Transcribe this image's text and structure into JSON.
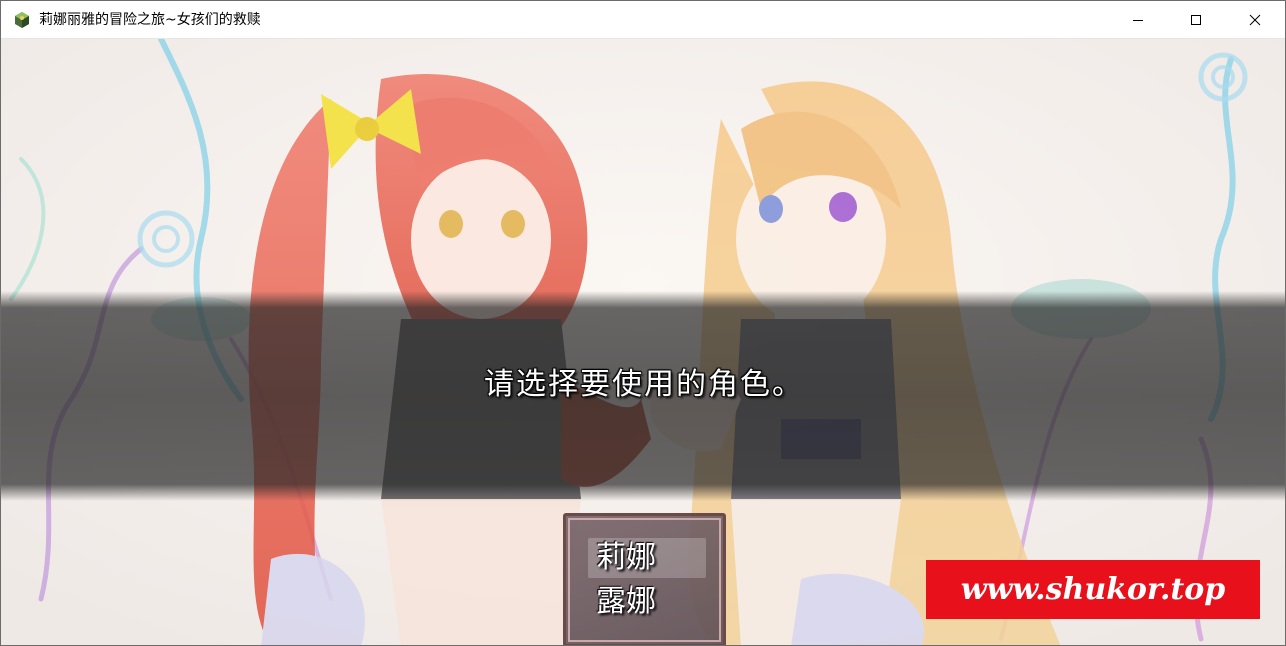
{
  "window": {
    "title": "莉娜丽雅的冒险之旅~女孩们的救赎",
    "controls": {
      "minimize_icon": "minimize-icon",
      "maximize_icon": "maximize-icon",
      "close_icon": "close-icon"
    }
  },
  "message": {
    "text": "请选择要使用的角色。"
  },
  "choices": {
    "selected_index": 0,
    "items": [
      {
        "label": "莉娜"
      },
      {
        "label": "露娜"
      }
    ]
  },
  "watermark": {
    "text": "www.shukor.top",
    "color": "#e8101a"
  },
  "colors": {
    "message_band": "#282828",
    "choice_border": "#6b4a4a"
  }
}
